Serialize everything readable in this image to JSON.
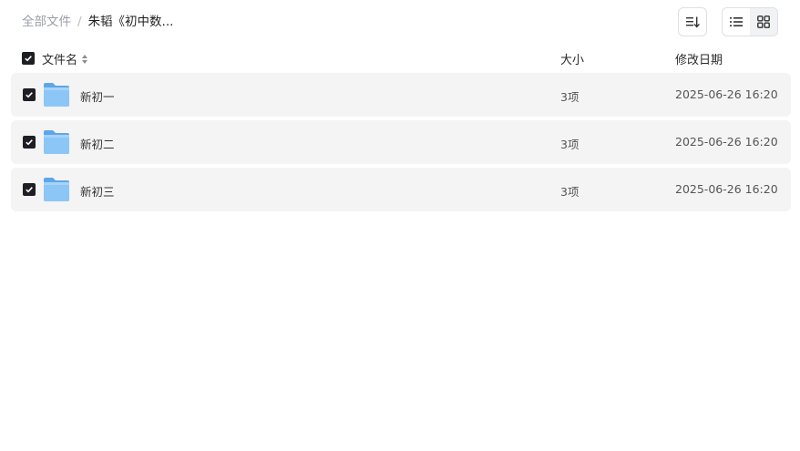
{
  "breadcrumb": {
    "root": "全部文件",
    "separator": "/",
    "current": "朱韬《初中数..."
  },
  "toolbar": {
    "sort_icon": "sort-list-icon",
    "view_list_icon": "list-view-icon",
    "view_grid_icon": "grid-view-icon"
  },
  "table": {
    "headers": {
      "name": "文件名",
      "size": "大小",
      "date": "修改日期"
    },
    "rows": [
      {
        "name": "新初一",
        "size": "3项",
        "date": "2025-06-26 16:20",
        "checked": true
      },
      {
        "name": "新初二",
        "size": "3项",
        "date": "2025-06-26 16:20",
        "checked": true
      },
      {
        "name": "新初三",
        "size": "3项",
        "date": "2025-06-26 16:20",
        "checked": true
      }
    ]
  },
  "colors": {
    "checkbox": "#1e1f24",
    "row_bg": "#f4f4f5",
    "folder": "#7ab9f3"
  }
}
